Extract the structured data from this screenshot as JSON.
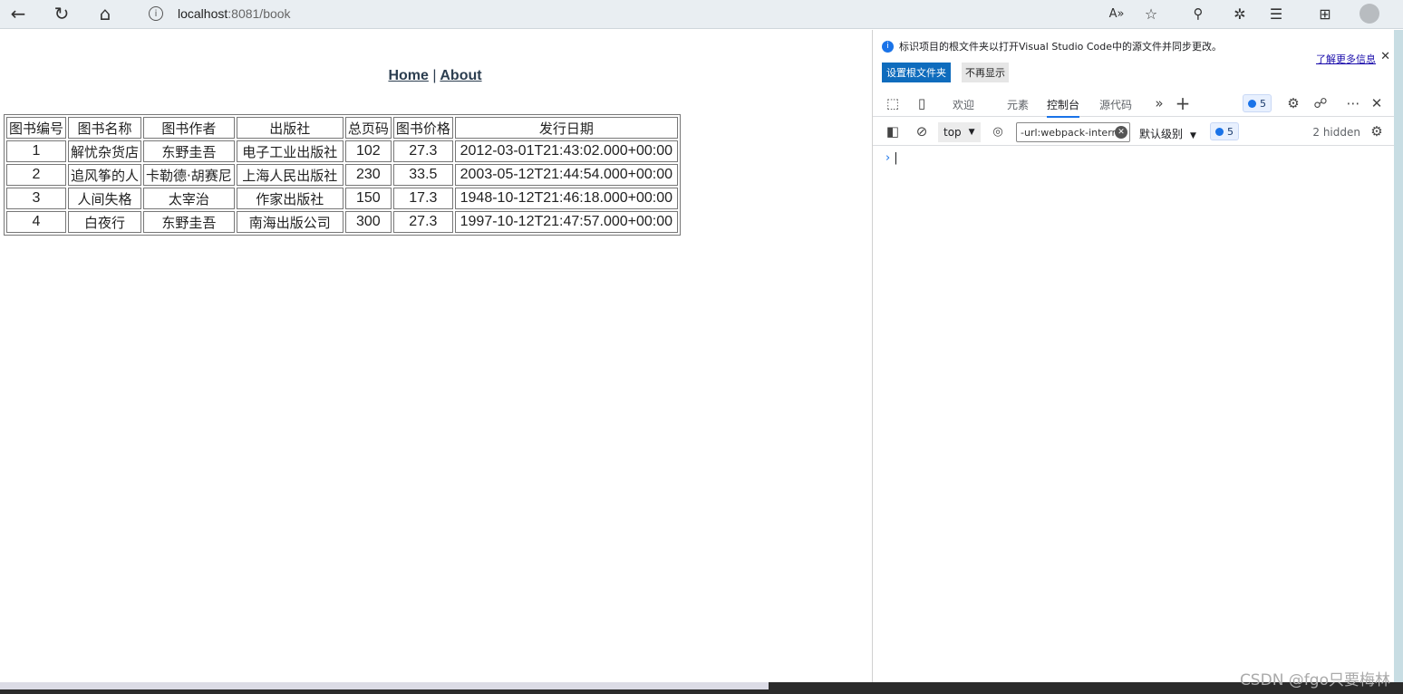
{
  "browser": {
    "url_host": "localhost",
    "url_rest": ":8081/book",
    "read_aloud": "A»"
  },
  "nav": {
    "home": "Home",
    "separator": "|",
    "about": "About"
  },
  "table": {
    "headers": [
      "图书编号",
      "图书名称",
      "图书作者",
      "出版社",
      "总页码",
      "图书价格",
      "发行日期"
    ],
    "rows": [
      [
        "1",
        "解忧杂货店",
        "东野圭吾",
        "电子工业出版社",
        "102",
        "27.3",
        "2012-03-01T21:43:02.000+00:00"
      ],
      [
        "2",
        "追风筝的人",
        "卡勒德·胡赛尼",
        "上海人民出版社",
        "230",
        "33.5",
        "2003-05-12T21:44:54.000+00:00"
      ],
      [
        "3",
        "人间失格",
        "太宰治",
        "作家出版社",
        "150",
        "17.3",
        "1948-10-12T21:46:18.000+00:00"
      ],
      [
        "4",
        "白夜行",
        "东野圭吾",
        "南海出版公司",
        "300",
        "27.3",
        "1997-10-12T21:47:57.000+00:00"
      ]
    ]
  },
  "devtools": {
    "notice_text": "标识项目的根文件夹以打开Visual Studio Code中的源文件并同步更改。",
    "learn_more": "了解更多信息",
    "btn_set_root": "设置根文件夹",
    "btn_dont_show": "不再显示",
    "tabs": [
      "欢迎",
      "元素",
      "控制台",
      "源代码"
    ],
    "active_tab": "控制台",
    "issues_count": "5",
    "context": "top",
    "filter_value": "-url:webpack-intern",
    "level": "默认级别",
    "hidden": "2 hidden"
  },
  "watermark": "CSDN @fgo只要梅林",
  "colors": {
    "accent": "#1a73e8",
    "nav_link": "#2c3e50"
  }
}
